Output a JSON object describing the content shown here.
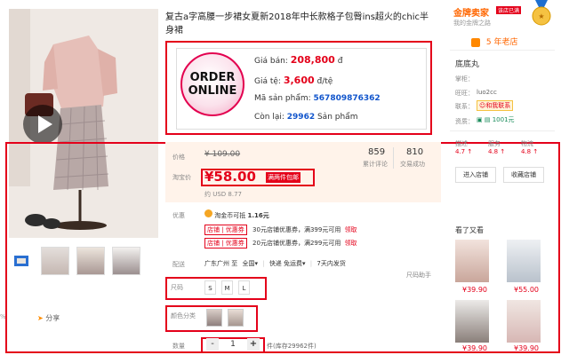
{
  "product": {
    "title": "复古a字高腰一步裙女夏新2018年中长款格子包臀ins超火的chic半身裙",
    "thumbs": [
      "thumb-video",
      "thumb-1",
      "thumb-2",
      "thumb-3"
    ]
  },
  "order_box": {
    "line1": "ORDER",
    "line2": "ONLINE",
    "price_label": "Giá bán:",
    "price_value": "208,800",
    "price_unit": "đ",
    "rate_label": "Giá tệ:",
    "rate_value": "3,600",
    "rate_unit": "đ/tệ",
    "code_label": "Mã sản phẩm:",
    "code_value": "567809876362",
    "stock_label": "Còn lại:",
    "stock_value": "29962",
    "stock_unit": "Sản phẩm"
  },
  "pricing": {
    "orig_label": "价格",
    "orig_price": "¥ 109.00",
    "promo_label": "淘宝价",
    "promo_price": "¥58.00",
    "promo_badge": "满两件包邮",
    "usd": "约 USD 8.77",
    "reviews_count": "859",
    "reviews_label": "累计评论",
    "sales_count": "810",
    "sales_label": "交易成功"
  },
  "promo": {
    "label": "优惠",
    "coin_text": "淘金币可抵",
    "coin_value": "1.16元",
    "coupon1_tag": "店铺 | 优惠券",
    "coupon1_text": "30元店铺优惠券，满399元可用",
    "coupon1_link": "领取",
    "coupon2_tag": "店铺 | 优惠券",
    "coupon2_text": "20元店铺优惠券，满299元可用",
    "coupon2_link": "领取"
  },
  "shipping": {
    "label": "配送",
    "origin": "广东广州 至",
    "dest": "全国",
    "method": "快递 免运费",
    "time": "7天内发货"
  },
  "size": {
    "label": "尺码",
    "options": [
      "S",
      "M",
      "L"
    ],
    "assistant": "尺码助手"
  },
  "color": {
    "label": "颜色分类"
  },
  "qty": {
    "label": "数量",
    "minus": "-",
    "value": "1",
    "plus": "+",
    "stock": "件(库存29962件)"
  },
  "share": {
    "label": "分享"
  },
  "shop": {
    "badge": "金牌卖家",
    "badge_tag": "该店已满",
    "badge_link": "我的金牌之路",
    "years_num": "5",
    "years_text": "年老店",
    "name": "底底丸",
    "owner_label": "掌柜：",
    "contact_label": "联系：",
    "contact_btn": "和我联系",
    "wangwang_label": "旺旺：",
    "wangwang_value": "luo2cc",
    "qual_label": "资质：",
    "qual_value": "1001元",
    "ratings": [
      {
        "label": "描述",
        "value": "4.7"
      },
      {
        "label": "服务",
        "value": "4.8"
      },
      {
        "label": "物流",
        "value": "4.8"
      }
    ],
    "enter_btn": "进入店铺",
    "fav_btn": "收藏店铺"
  },
  "seen": {
    "title": "看了又看",
    "items": [
      {
        "price": "¥39.90"
      },
      {
        "price": "¥55.00"
      },
      {
        "price": "¥39.90"
      },
      {
        "price": "¥39.90"
      }
    ]
  },
  "colors": {
    "accent": "#e4001a",
    "orange": "#ff6600",
    "link": "#1155cc"
  }
}
